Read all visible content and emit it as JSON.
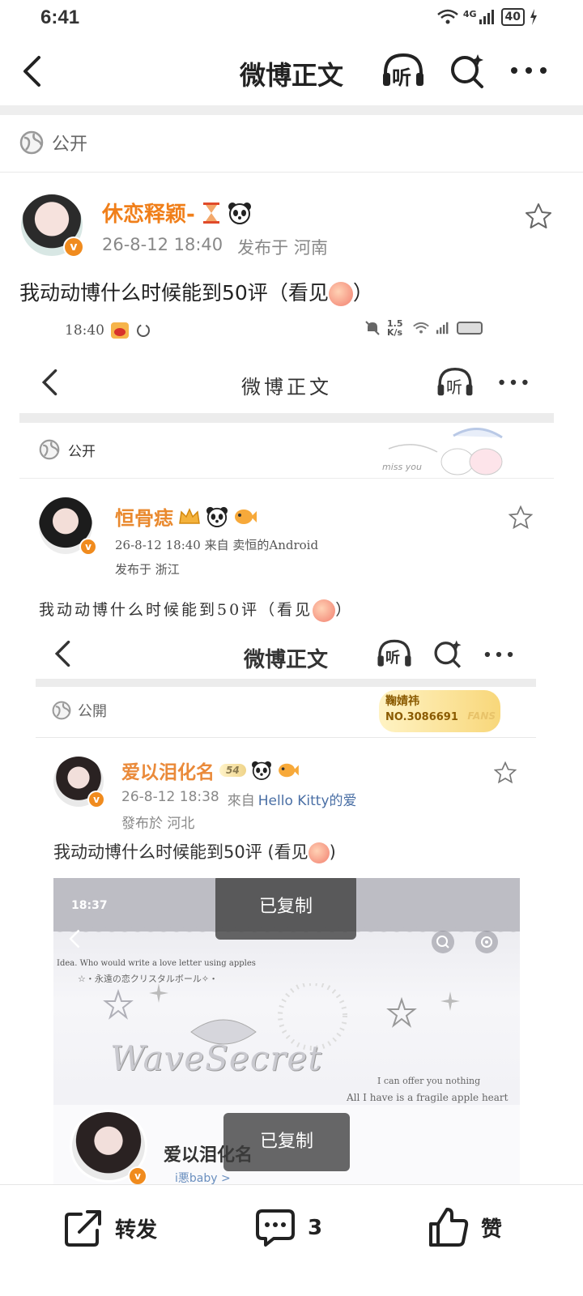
{
  "status_bar": {
    "time": "6:41",
    "network": "4G",
    "battery": "40"
  },
  "nav": {
    "title": "微博正文",
    "listen_label": "听"
  },
  "visibility": {
    "label": "公开"
  },
  "post": {
    "username": "休恋释颖-",
    "timestamp": "26-8-12 18:40",
    "location": "发布于 河南",
    "text": "我动动博什么时候能到50评（看见",
    "text_end": "）"
  },
  "shot1": {
    "status_time": "18:40",
    "net_speed": "1.5 K/s",
    "nav_title": "微博正文",
    "listen_label": "听",
    "visibility": "公开",
    "sticker_text": "miss you",
    "username": "恒骨痣",
    "meta": "26-8-12 18:40  来自 卖恒的Android",
    "location": "发布于 浙江",
    "text": "我动动博什么时候能到50评（看见",
    "text_end": "）"
  },
  "shot2": {
    "nav_title": "微博正文",
    "listen_label": "听",
    "visibility": "公開",
    "fans_name": "鞠婧祎",
    "fans_no": "NO.3086691",
    "fans_tag": "FANS",
    "username": "爱以泪化名",
    "level": "54",
    "timestamp": "26-8-12 18:38",
    "source_prefix": "來自",
    "source": "Hello Kitty的爱",
    "location": "發布於 河北",
    "text": "我动动博什么时候能到50评 (看见",
    "text_end": ")"
  },
  "shot3": {
    "status_time": "18:37",
    "line1": "Idea. Who would write a love letter using apples",
    "line2": "☆・永遠の恋クリスタルボール✧・",
    "brand": "WaveSecret",
    "quote1": "I can offer you nothing",
    "quote2": "All I have is a fragile apple heart",
    "username": "爱以泪化名",
    "sub": "i悪baby >",
    "toast_top": "已复制",
    "toast_bottom": "已复制"
  },
  "bottom_bar": {
    "repost": "转发",
    "comment_count": "3",
    "like": "赞"
  },
  "colors": {
    "accent": "#f07f1a",
    "badge": "#f08b1e",
    "text": "#222222",
    "meta": "#888888"
  }
}
